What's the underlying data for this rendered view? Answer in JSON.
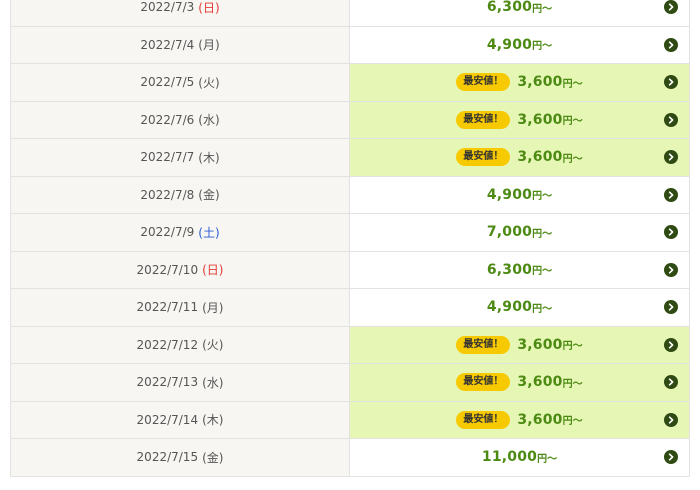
{
  "badge_label": "最安値！",
  "unit_label": "円～",
  "rows": [
    {
      "date": "2022/7/3",
      "dow": "(日)",
      "price": "6,300",
      "cheapest": false,
      "dow_type": "sun"
    },
    {
      "date": "2022/7/4",
      "dow": "(月)",
      "price": "4,900",
      "cheapest": false,
      "dow_type": "weekday"
    },
    {
      "date": "2022/7/5",
      "dow": "(火)",
      "price": "3,600",
      "cheapest": true,
      "dow_type": "weekday"
    },
    {
      "date": "2022/7/6",
      "dow": "(水)",
      "price": "3,600",
      "cheapest": true,
      "dow_type": "weekday"
    },
    {
      "date": "2022/7/7",
      "dow": "(木)",
      "price": "3,600",
      "cheapest": true,
      "dow_type": "weekday"
    },
    {
      "date": "2022/7/8",
      "dow": "(金)",
      "price": "4,900",
      "cheapest": false,
      "dow_type": "weekday"
    },
    {
      "date": "2022/7/9",
      "dow": "(土)",
      "price": "7,000",
      "cheapest": false,
      "dow_type": "sat"
    },
    {
      "date": "2022/7/10",
      "dow": "(日)",
      "price": "6,300",
      "cheapest": false,
      "dow_type": "sun"
    },
    {
      "date": "2022/7/11",
      "dow": "(月)",
      "price": "4,900",
      "cheapest": false,
      "dow_type": "weekday"
    },
    {
      "date": "2022/7/12",
      "dow": "(火)",
      "price": "3,600",
      "cheapest": true,
      "dow_type": "weekday"
    },
    {
      "date": "2022/7/13",
      "dow": "(水)",
      "price": "3,600",
      "cheapest": true,
      "dow_type": "weekday"
    },
    {
      "date": "2022/7/14",
      "dow": "(木)",
      "price": "3,600",
      "cheapest": true,
      "dow_type": "weekday"
    },
    {
      "date": "2022/7/15",
      "dow": "(金)",
      "price": "11,000",
      "cheapest": false,
      "dow_type": "weekday"
    }
  ],
  "colors": {
    "cheapest_bg": "#e6f7b5",
    "price_text": "#4c8a13",
    "badge_bg": "#f7c900",
    "sunday": "#e53935",
    "saturday": "#2e5bd8",
    "arrow_bg": "#2f4a12"
  },
  "icons": {
    "row_arrow": "chevron-right-circle-icon"
  }
}
